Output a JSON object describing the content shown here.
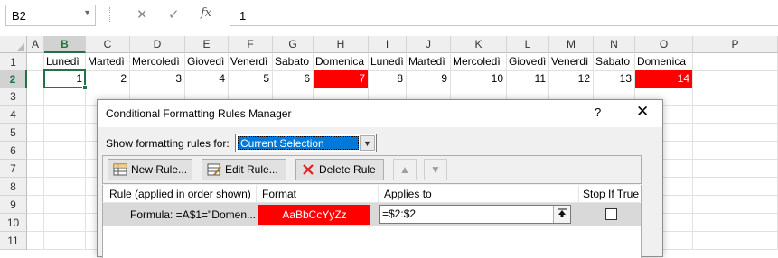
{
  "formula_bar": {
    "name_box": "B2",
    "cancel_icon": "✕",
    "enter_icon": "✓",
    "fx_icon": "fx",
    "value": "1"
  },
  "sheet": {
    "columns": [
      "A",
      "B",
      "C",
      "D",
      "E",
      "F",
      "G",
      "H",
      "I",
      "J",
      "K",
      "L",
      "M",
      "N",
      "O",
      "P"
    ],
    "selected_column": "B",
    "rows": [
      "1",
      "2",
      "3",
      "4",
      "5",
      "6",
      "7",
      "8",
      "9",
      "10",
      "11"
    ],
    "selected_row": "2",
    "row1": [
      "Lunedì",
      "Martedì",
      "Mercoledì",
      "Giovedì",
      "Venerdì",
      "Sabato",
      "Domenica",
      "Lunedì",
      "Martedì",
      "Mercoledì",
      "Giovedì",
      "Venerdì",
      "Sabato",
      "Domenica"
    ],
    "row2": [
      "1",
      "2",
      "3",
      "4",
      "5",
      "6",
      "7",
      "8",
      "9",
      "10",
      "11",
      "12",
      "13",
      "14"
    ],
    "highlight_color": "#ff0000",
    "selection_color": "#217346"
  },
  "dialog": {
    "title": "Conditional Formatting Rules Manager",
    "help": "?",
    "close": "✕",
    "show_label": "Show formatting rules for:",
    "show_value": "Current Selection",
    "buttons": {
      "new_rule": "New Rule...",
      "edit_rule": "Edit Rule...",
      "delete_rule": "Delete Rule",
      "move_up": "▲",
      "move_down": "▼"
    },
    "headers": {
      "rule": "Rule (applied in order shown)",
      "format": "Format",
      "applies_to": "Applies to",
      "stop_if_true": "Stop If True"
    },
    "rules": [
      {
        "formula": "Formula: =A$1=\"Domen...",
        "format_preview": "AaBbCcYyZz",
        "applies_to": "=$2:$2",
        "stop_if_true": false
      }
    ]
  }
}
